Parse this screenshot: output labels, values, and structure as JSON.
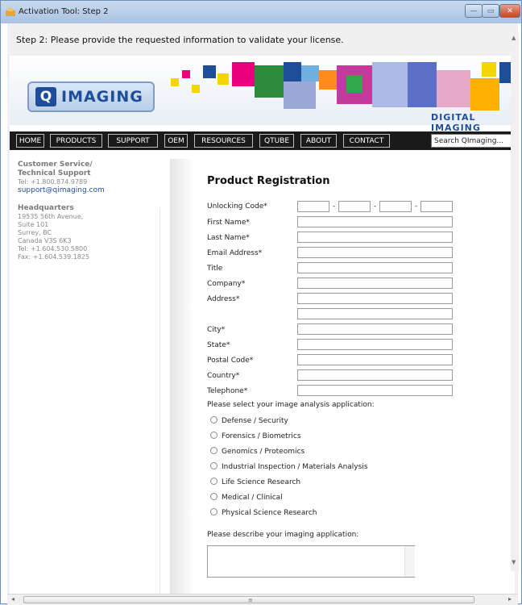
{
  "window": {
    "title": "Activation Tool: Step 2",
    "min": "—",
    "max": "▭",
    "close": "✕"
  },
  "step_text": "Step 2: Please provide the requested information to validate your license.",
  "banner": {
    "logo_letter": "Q",
    "logo_text": "IMAGING",
    "slogan": "DIGITAL IMAGING"
  },
  "nav": {
    "items": [
      "HOME",
      "PRODUCTS",
      "SUPPORT",
      "OEM",
      "RESOURCES",
      "QTUBE",
      "ABOUT",
      "CONTACT"
    ],
    "search_value": "Search QImaging..."
  },
  "sidebar": {
    "support_heading_1": "Customer Service/",
    "support_heading_2": "Technical Support",
    "support_tel": "Tel: +1.800.874.9789",
    "support_email": "support@qimaging.com",
    "hq_heading": "Headquarters",
    "hq_lines": [
      "19535 56th Avenue,",
      "Suite 101",
      "Surrey, BC",
      "Canada V3S 6K3",
      "Tel: +1.604.530.5800",
      "Fax: +1.604.539.1825"
    ]
  },
  "form": {
    "title": "Product Registration",
    "unlocking_code": "Unlocking Code*",
    "first_name": "First Name*",
    "last_name": "Last Name*",
    "email": "Email Address*",
    "title_field": "Title",
    "company": "Company*",
    "address": "Address*",
    "city": "City*",
    "state": "State*",
    "postal": "Postal Code*",
    "country": "Country*",
    "telephone": "Telephone*",
    "select_prompt": "Please select your image analysis application:",
    "options": [
      "Defense / Security",
      "Forensics / Biometrics",
      "Genomics / Proteomics",
      "Industrial Inspection / Materials Analysis",
      "Life Science Research",
      "Medical / Clinical",
      "Physical Science Research"
    ],
    "describe_prompt": "Please describe your imaging application:",
    "dash": "-"
  },
  "colors": {
    "brand": "#1e4e9a",
    "nav_bg": "#1a1a1a"
  }
}
